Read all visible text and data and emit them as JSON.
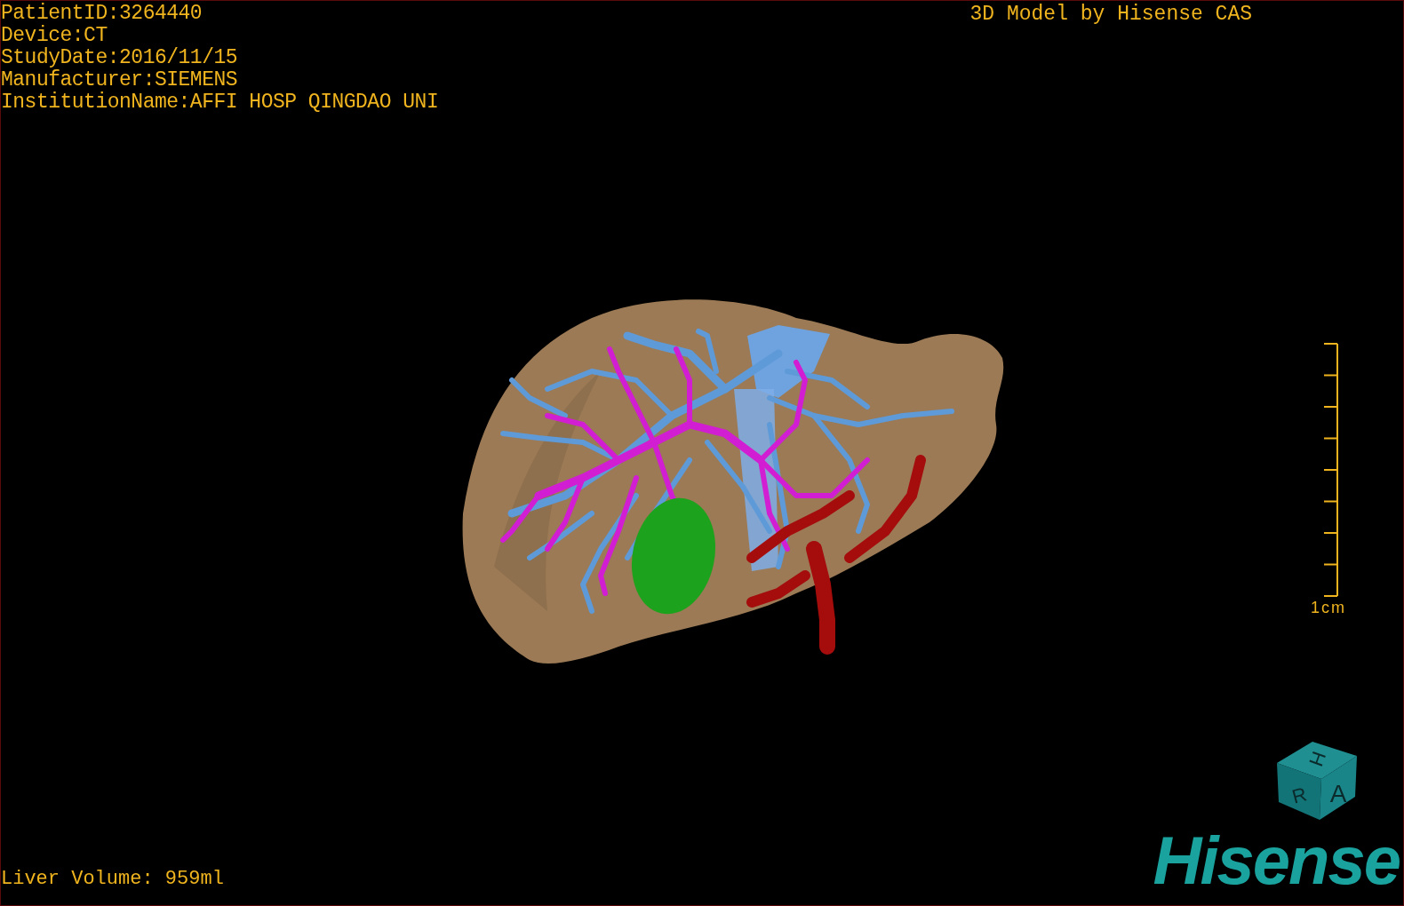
{
  "patient_info": [
    "PatientID:3264440",
    "Device:CT",
    "StudyDate:2016/11/15",
    "Manufacturer:SIEMENS",
    "InstitutionName:AFFI HOSP QINGDAO UNI"
  ],
  "title": "3D Model by Hisense CAS",
  "scale_bar": {
    "label": "1cm"
  },
  "liver_volume": "Liver Volume: 959ml",
  "orientation_cube": {
    "labels": [
      "H",
      "R",
      "A"
    ]
  },
  "logo": "Hisense"
}
